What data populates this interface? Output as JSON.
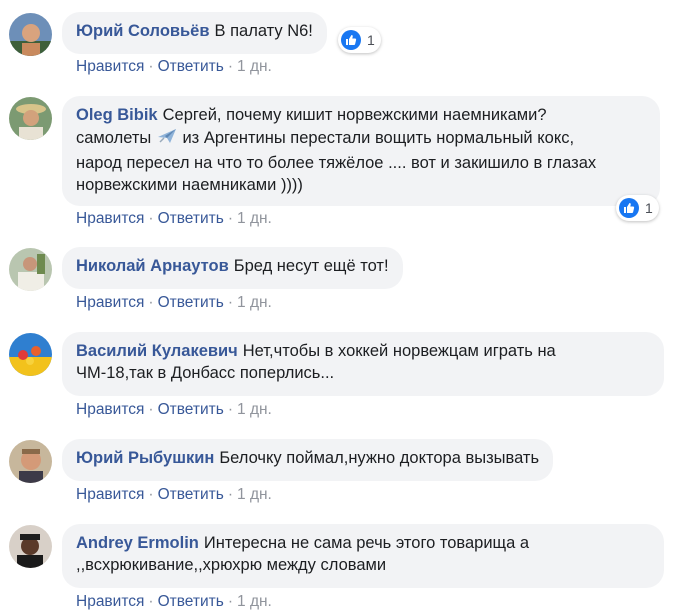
{
  "actions": {
    "like": "Нравится",
    "reply": "Ответить",
    "sep": "·"
  },
  "comments": [
    {
      "author": "Юрий Соловьёв",
      "text": "В палату N6!",
      "time": "1 дн.",
      "reactions": "1"
    },
    {
      "author": "Oleg Bibik",
      "text1": "Сергей, почему кишит норвежскими наемниками?",
      "text2a": "самолеты",
      "text2b": "из Аргентины перестали вощить нормальный кокс,",
      "text3": "народ пересел на что то более тяжёлое .... вот и закишило в глазах",
      "text4": "норвежскими наемниками ))))",
      "time": "1 дн.",
      "reactions": "1"
    },
    {
      "author": "Николай Арнаутов",
      "text": "Бред несут ещё тот!",
      "time": "1 дн."
    },
    {
      "author": "Василий Кулакевич",
      "text1": "Нет,чтобы в хоккей норвежцам играть на",
      "text2": "ЧМ-18,так в Донбасс поперлись...",
      "time": "1 дн."
    },
    {
      "author": "Юрий Рыбушкин",
      "text": "Белочку поймал,нужно доктора вызывать",
      "time": "1 дн."
    },
    {
      "author": "Andrey Ermolin",
      "text1": "Интересна не сама речь этого товарища а",
      "text2": ",,всхрюкивание,,хрюхрю между словами",
      "time": "1 дн."
    }
  ],
  "icons": {
    "like": "thumbs-up-icon",
    "plane": "airplane-emoji"
  },
  "colors": {
    "author": "#385898",
    "bubble": "#f2f3f5",
    "like": "#1877f2"
  }
}
